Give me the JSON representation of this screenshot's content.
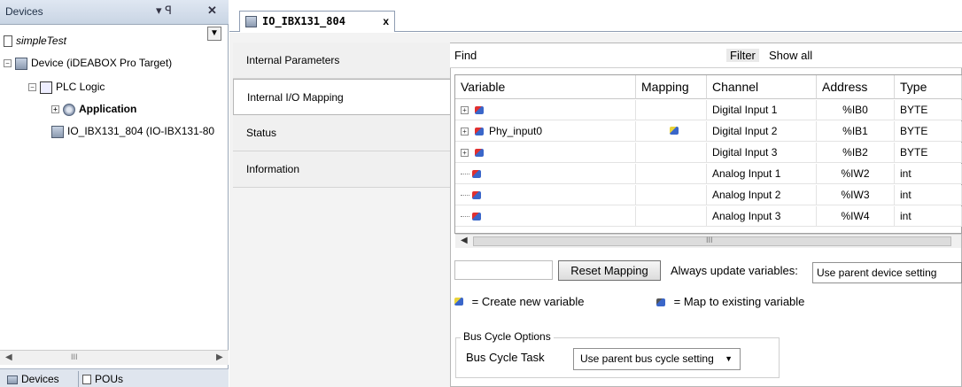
{
  "devices_panel": {
    "title": "Devices",
    "pin_glyph": "▾  ꟼ",
    "close_glyph": "✕",
    "tree": [
      {
        "label": "simpleTest"
      },
      {
        "label": "Device (iDEABOX Pro Target)"
      },
      {
        "label": "PLC Logic"
      },
      {
        "label": "Application"
      },
      {
        "label": "IO_IBX131_804 (IO-IBX131-80"
      }
    ],
    "scroll_grip": "III",
    "bottom_tabs": [
      "Devices",
      "POUs"
    ]
  },
  "editor": {
    "tab_title": "IO_IBX131_804",
    "tab_close": "x",
    "side_tabs": [
      "Internal Parameters",
      "Internal I/O Mapping",
      "Status",
      "Information"
    ],
    "find_label": "Find",
    "filter_label": "Filter",
    "filter_value": "Show all",
    "columns": [
      "Variable",
      "Mapping",
      "Channel",
      "Address",
      "Type"
    ],
    "rows": [
      {
        "variable": "",
        "mapped": false,
        "channel": "Digital Input 1",
        "address": "%IB0",
        "type": "BYTE",
        "expandable": true
      },
      {
        "variable": "Phy_input0",
        "mapped": true,
        "channel": "Digital Input 2",
        "address": "%IB1",
        "type": "BYTE",
        "expandable": true
      },
      {
        "variable": "",
        "mapped": false,
        "channel": "Digital Input 3",
        "address": "%IB2",
        "type": "BYTE",
        "expandable": true
      },
      {
        "variable": "",
        "mapped": false,
        "channel": "Analog Input 1",
        "address": "%IW2",
        "type": "int",
        "expandable": false
      },
      {
        "variable": "",
        "mapped": false,
        "channel": "Analog Input 2",
        "address": "%IW3",
        "type": "int",
        "expandable": false
      },
      {
        "variable": "",
        "mapped": false,
        "channel": "Analog Input 3",
        "address": "%IW4",
        "type": "int",
        "expandable": false
      }
    ],
    "grid_scroll_grip": "III",
    "reset_mapping": "Reset Mapping",
    "always_update_label": "Always update variables:",
    "always_update_value": "Use parent device setting",
    "legend_create": "= Create new variable",
    "legend_map": "= Map to existing variable",
    "bus_cycle_group": "Bus Cycle Options",
    "bus_cycle_task_label": "Bus Cycle Task",
    "bus_cycle_task_value": "Use parent bus cycle setting"
  }
}
